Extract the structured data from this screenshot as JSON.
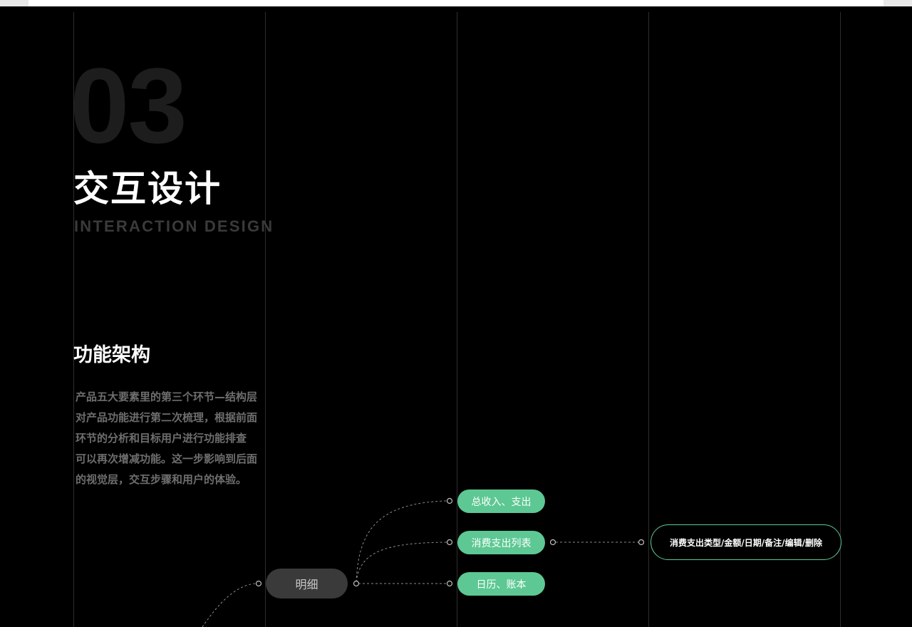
{
  "header": {
    "number": "03",
    "title_zh": "交互设计",
    "title_en": "INTERACTION DESIGN"
  },
  "section": {
    "title": "功能架构",
    "description_lines": [
      "产品五大要素里的第三个环节—结构层",
      "对产品功能进行第二次梳理，根据前面",
      "环节的分析和目标用户进行功能排查",
      "可以再次增减功能。这一步影响到后面",
      "的视觉层，交互步骤和用户的体验。"
    ]
  },
  "mindmap": {
    "parent_node": "明细",
    "children": [
      "总收入、支出",
      "消费支出列表",
      "日历、账本"
    ],
    "detail_node": "消费支出类型/金额/日期/备注/编辑/删除"
  },
  "colors": {
    "background": "#000000",
    "accent_green": "#5dc893",
    "parent_node_bg": "#3a3a3a",
    "gridline": "#2e2e2e",
    "big_number": "#1d1d1d",
    "subtitle_grey": "#3a3a3a",
    "body_text_grey": "#6e6e6e"
  }
}
